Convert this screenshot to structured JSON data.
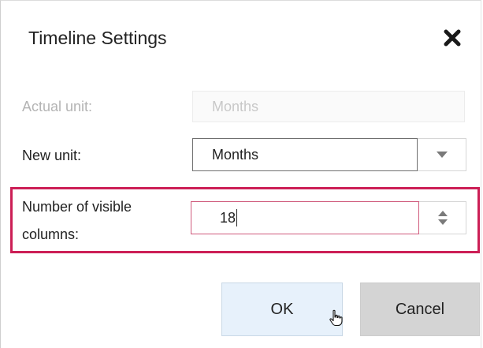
{
  "dialog": {
    "title": "Timeline Settings",
    "close_icon": "close-icon"
  },
  "actual_unit": {
    "label": "Actual unit:",
    "value": "Months",
    "disabled": true
  },
  "new_unit": {
    "label": "New unit:",
    "value": "Months",
    "arrow_icon": "chevron-down-icon"
  },
  "visible_columns": {
    "label_line1": "Number of visible",
    "label_line2": "columns:",
    "value": "18",
    "spinner_icon": "spinner-updown-icon"
  },
  "buttons": {
    "ok_label": "OK",
    "cancel_label": "Cancel"
  },
  "colors": {
    "highlight": "#cc1f56",
    "ok_bg": "#e7f1fb",
    "cancel_bg": "#d4d4d4"
  }
}
